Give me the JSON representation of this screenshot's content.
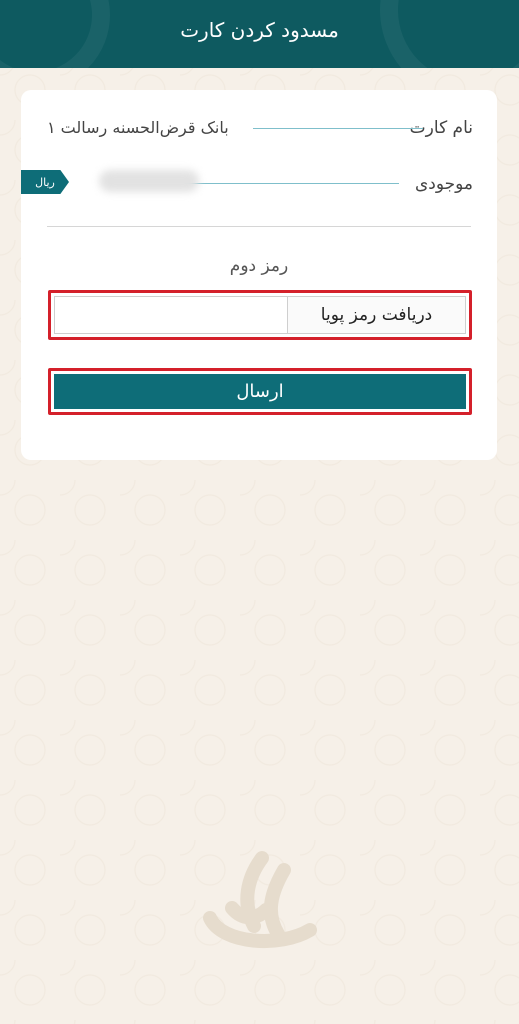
{
  "header": {
    "title": "مسدود کردن کارت"
  },
  "card_info": {
    "card_name_label": "نام کارت",
    "card_name_value": "بانک قرض‌الحسنه رسالت ۱",
    "balance_label": "موجودی",
    "currency": "ریال"
  },
  "second_pin": {
    "label": "رمز دوم",
    "dynamic_pin_button": "دریافت رمز پویا",
    "input_value": "",
    "input_placeholder": ""
  },
  "actions": {
    "submit_label": "ارسال"
  },
  "colors": {
    "header_bg": "#0e5a60",
    "button_bg": "#0e6d78",
    "highlight_border": "#d4202a",
    "page_bg": "#f6f0e8"
  },
  "icons": {
    "watermark": "resalat-logo-watermark"
  }
}
